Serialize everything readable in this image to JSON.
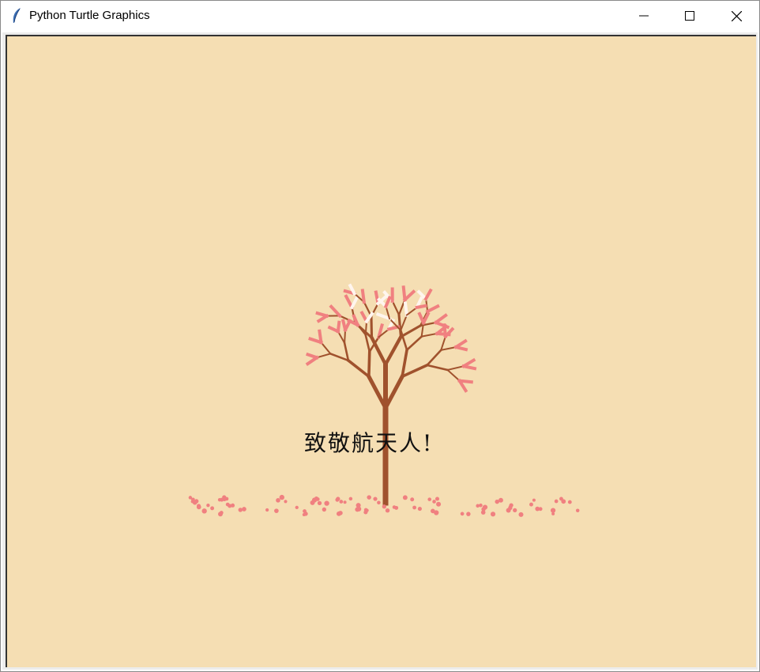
{
  "window": {
    "title": "Python Turtle Graphics",
    "icon": "feather-icon",
    "controls": [
      "minimize-icon",
      "maximize-icon",
      "close-icon"
    ]
  },
  "canvas": {
    "background": "#f5deb3",
    "greeting": "致敬航天人!",
    "trunk_color": "#a0522d",
    "blossom_colors": [
      "#f08080",
      "#fff5ee"
    ],
    "petal_color": "#f08080"
  }
}
